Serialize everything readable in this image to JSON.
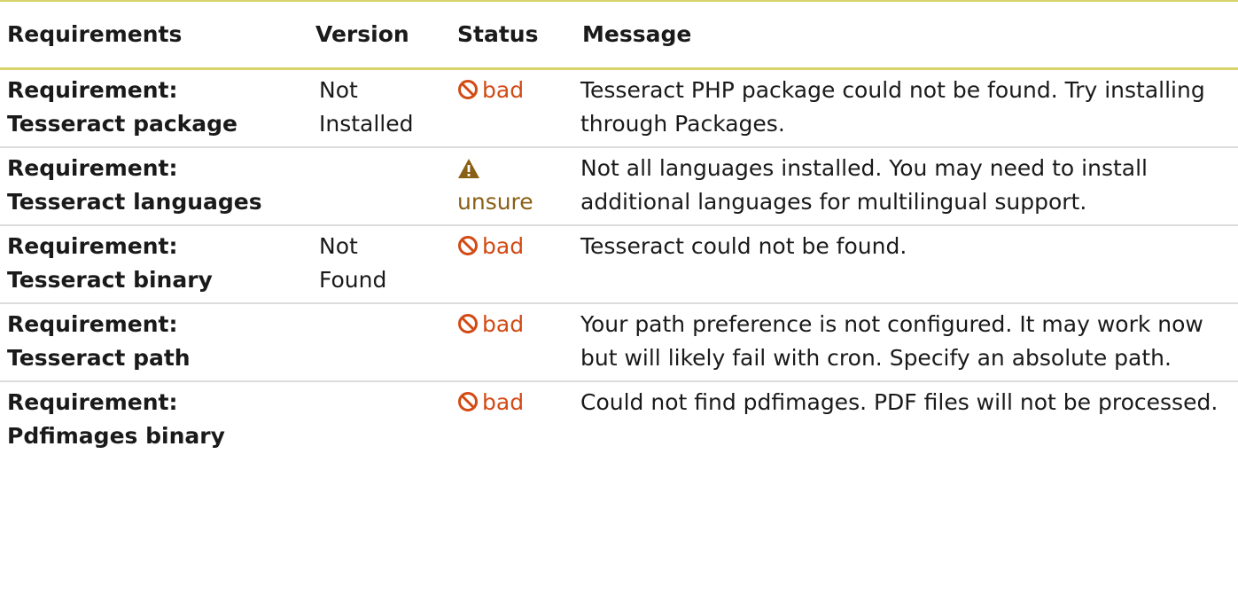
{
  "table": {
    "headers": [
      "Requirements",
      "Version",
      "Status",
      "Message"
    ],
    "rows": [
      {
        "name_line1": "Requirement:",
        "name_line2": "Tesseract package",
        "version_line1": "Not",
        "version_line2": "Installed",
        "status": "bad",
        "status_icon": "ban-icon",
        "message": "Tesseract PHP package could not be found. Try installing through Packages."
      },
      {
        "name_line1": "Requirement:",
        "name_line2": "Tesseract languages",
        "version_line1": "",
        "version_line2": "",
        "status": "unsure",
        "status_icon": "warning-icon",
        "message": "Not all languages installed. You may need to install additional languages for multilingual support."
      },
      {
        "name_line1": "Requirement:",
        "name_line2": "Tesseract binary",
        "version_line1": "Not",
        "version_line2": "Found",
        "status": "bad",
        "status_icon": "ban-icon",
        "message": "Tesseract could not be found."
      },
      {
        "name_line1": "Requirement:",
        "name_line2": "Tesseract path",
        "version_line1": "",
        "version_line2": "",
        "status": "bad",
        "status_icon": "ban-icon",
        "message": "Your path preference is not configured. It may work now but will likely fail with cron. Specify an absolute path."
      },
      {
        "name_line1": "Requirement:",
        "name_line2": "Pdfimages binary",
        "version_line1": "",
        "version_line2": "",
        "status": "bad",
        "status_icon": "ban-icon",
        "message": "Could not find pdfimages. PDF files will not be processed."
      }
    ]
  },
  "colors": {
    "bad": "#d24a14",
    "unsure": "#8a6016",
    "header_rule": "#d8d36a",
    "row_rule": "#dcdcdc"
  }
}
